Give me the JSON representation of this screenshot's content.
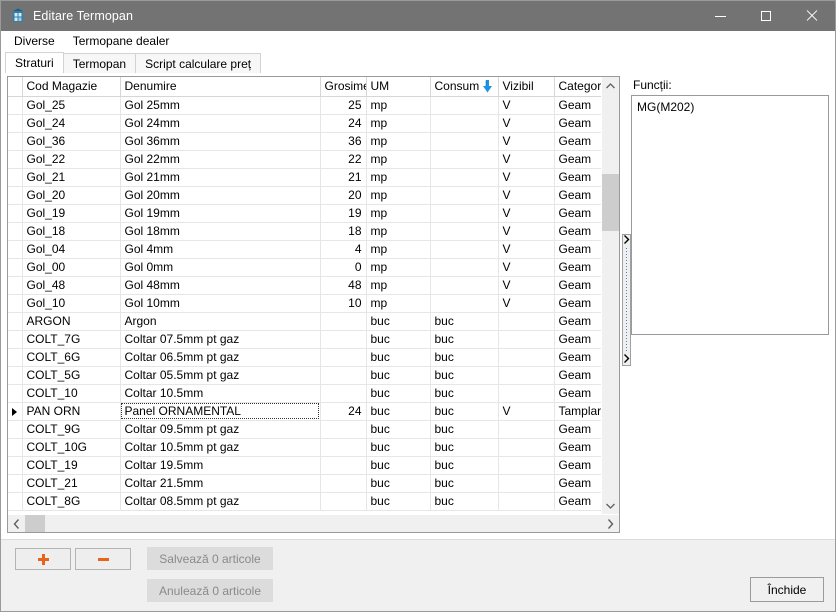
{
  "window": {
    "title": "Editare Termopan",
    "icon": "app-window-icon",
    "controls": {
      "minimize": "minimize-icon",
      "maximize": "maximize-icon",
      "close": "close-icon"
    }
  },
  "menubar": {
    "items": [
      {
        "label": "Diverse"
      },
      {
        "label": "Termopane dealer"
      }
    ]
  },
  "tabs": [
    {
      "label": "Straturi",
      "active": true
    },
    {
      "label": "Termopan",
      "active": false
    },
    {
      "label": "Script calculare preț",
      "active": false
    }
  ],
  "grid": {
    "columns": [
      {
        "label": "",
        "key": "marker",
        "align": "center"
      },
      {
        "label": "Cod Magazie",
        "key": "cod",
        "align": "left"
      },
      {
        "label": "Denumire",
        "key": "denumire",
        "align": "left"
      },
      {
        "label": "Grosime",
        "key": "grosime",
        "align": "right"
      },
      {
        "label": "UM",
        "key": "um",
        "align": "left"
      },
      {
        "label": "Consum",
        "key": "consum",
        "align": "left",
        "sort": "descending"
      },
      {
        "label": "Vizibil",
        "key": "vizibil",
        "align": "left"
      },
      {
        "label": "CategorieC",
        "key": "categorie",
        "align": "left"
      }
    ],
    "sort_indicator": "sort-descending-arrow",
    "rows": [
      {
        "marker": "",
        "cod": "Gol_25",
        "denumire": "Gol 25mm",
        "grosime": "25",
        "um": "mp",
        "consum": "",
        "vizibil": "V",
        "categorie": "Geam",
        "selected": false
      },
      {
        "marker": "",
        "cod": "Gol_24",
        "denumire": "Gol 24mm",
        "grosime": "24",
        "um": "mp",
        "consum": "",
        "vizibil": "V",
        "categorie": "Geam",
        "selected": false
      },
      {
        "marker": "",
        "cod": "Gol_36",
        "denumire": "Gol 36mm",
        "grosime": "36",
        "um": "mp",
        "consum": "",
        "vizibil": "V",
        "categorie": "Geam",
        "selected": false
      },
      {
        "marker": "",
        "cod": "Gol_22",
        "denumire": "Gol 22mm",
        "grosime": "22",
        "um": "mp",
        "consum": "",
        "vizibil": "V",
        "categorie": "Geam",
        "selected": false
      },
      {
        "marker": "",
        "cod": "Gol_21",
        "denumire": "Gol 21mm",
        "grosime": "21",
        "um": "mp",
        "consum": "",
        "vizibil": "V",
        "categorie": "Geam",
        "selected": false
      },
      {
        "marker": "",
        "cod": "Gol_20",
        "denumire": "Gol 20mm",
        "grosime": "20",
        "um": "mp",
        "consum": "",
        "vizibil": "V",
        "categorie": "Geam",
        "selected": false
      },
      {
        "marker": "",
        "cod": "Gol_19",
        "denumire": "Gol 19mm",
        "grosime": "19",
        "um": "mp",
        "consum": "",
        "vizibil": "V",
        "categorie": "Geam",
        "selected": false
      },
      {
        "marker": "",
        "cod": "Gol_18",
        "denumire": "Gol 18mm",
        "grosime": "18",
        "um": "mp",
        "consum": "",
        "vizibil": "V",
        "categorie": "Geam",
        "selected": false
      },
      {
        "marker": "",
        "cod": "Gol_04",
        "denumire": "Gol 4mm",
        "grosime": "4",
        "um": "mp",
        "consum": "",
        "vizibil": "V",
        "categorie": "Geam",
        "selected": false
      },
      {
        "marker": "",
        "cod": "Gol_00",
        "denumire": "Gol 0mm",
        "grosime": "0",
        "um": "mp",
        "consum": "",
        "vizibil": "V",
        "categorie": "Geam",
        "selected": false
      },
      {
        "marker": "",
        "cod": "Gol_48",
        "denumire": "Gol 48mm",
        "grosime": "48",
        "um": "mp",
        "consum": "",
        "vizibil": "V",
        "categorie": "Geam",
        "selected": false
      },
      {
        "marker": "",
        "cod": "Gol_10",
        "denumire": "Gol 10mm",
        "grosime": "10",
        "um": "mp",
        "consum": "",
        "vizibil": "V",
        "categorie": "Geam",
        "selected": false
      },
      {
        "marker": "",
        "cod": "ARGON",
        "denumire": "Argon",
        "grosime": "",
        "um": "buc",
        "consum": "buc",
        "vizibil": "",
        "categorie": "Geam",
        "selected": false
      },
      {
        "marker": "",
        "cod": "COLT_7G",
        "denumire": "Coltar 07.5mm pt gaz",
        "grosime": "",
        "um": "buc",
        "consum": "buc",
        "vizibil": "",
        "categorie": "Geam",
        "selected": false
      },
      {
        "marker": "",
        "cod": "COLT_6G",
        "denumire": "Coltar 06.5mm pt gaz",
        "grosime": "",
        "um": "buc",
        "consum": "buc",
        "vizibil": "",
        "categorie": "Geam",
        "selected": false
      },
      {
        "marker": "",
        "cod": "COLT_5G",
        "denumire": "Coltar 05.5mm pt gaz",
        "grosime": "",
        "um": "buc",
        "consum": "buc",
        "vizibil": "",
        "categorie": "Geam",
        "selected": false
      },
      {
        "marker": "",
        "cod": "COLT_10",
        "denumire": "Coltar 10.5mm",
        "grosime": "",
        "um": "buc",
        "consum": "buc",
        "vizibil": "",
        "categorie": "Geam",
        "selected": false
      },
      {
        "marker": "current-row-arrow",
        "cod": "PAN ORN",
        "denumire": "Panel ORNAMENTAL",
        "grosime": "24",
        "um": "buc",
        "consum": "buc",
        "vizibil": "V",
        "categorie": "Tamplarie",
        "selected": true
      },
      {
        "marker": "",
        "cod": "COLT_9G",
        "denumire": "Coltar 09.5mm  pt gaz",
        "grosime": "",
        "um": "buc",
        "consum": "buc",
        "vizibil": "",
        "categorie": "Geam",
        "selected": false
      },
      {
        "marker": "",
        "cod": "COLT_10G",
        "denumire": "Coltar 10.5mm pt gaz",
        "grosime": "",
        "um": "buc",
        "consum": "buc",
        "vizibil": "",
        "categorie": "Geam",
        "selected": false
      },
      {
        "marker": "",
        "cod": "COLT_19",
        "denumire": "Coltar 19.5mm",
        "grosime": "",
        "um": "buc",
        "consum": "buc",
        "vizibil": "",
        "categorie": "Geam",
        "selected": false
      },
      {
        "marker": "",
        "cod": "COLT_21",
        "denumire": "Coltar 21.5mm",
        "grosime": "",
        "um": "buc",
        "consum": "buc",
        "vizibil": "",
        "categorie": "Geam",
        "selected": false
      },
      {
        "marker": "",
        "cod": "COLT_8G",
        "denumire": "Coltar 08.5mm  pt gaz",
        "grosime": "",
        "um": "buc",
        "consum": "buc",
        "vizibil": "",
        "categorie": "Geam",
        "selected": false
      }
    ],
    "vscroll": {
      "up_icon": "chevron-up-icon",
      "down_icon": "chevron-down-icon"
    },
    "hscroll": {
      "left_icon": "chevron-left-icon",
      "right_icon": "chevron-right-icon"
    }
  },
  "splitter": {
    "collapse_left_icon": "chevron-right-icon",
    "collapse_right_icon": "chevron-right-icon"
  },
  "right_panel": {
    "label": "Funcții:",
    "items": [
      {
        "label": "MG(M202)"
      }
    ]
  },
  "bottom_bar": {
    "add_label": "",
    "remove_label": "",
    "add_icon": "plus-icon",
    "remove_icon": "minus-icon",
    "save_label": "Salvează 0 articole",
    "cancel_label": "Anulează 0 articole",
    "close_label": "Închide",
    "save_enabled": false,
    "cancel_enabled": false
  },
  "colors": {
    "titlebar": "#737373",
    "accent_selection": "#8ecbf5",
    "icon_orange": "#e8641c",
    "sort_arrow_blue": "#1e90e6"
  }
}
